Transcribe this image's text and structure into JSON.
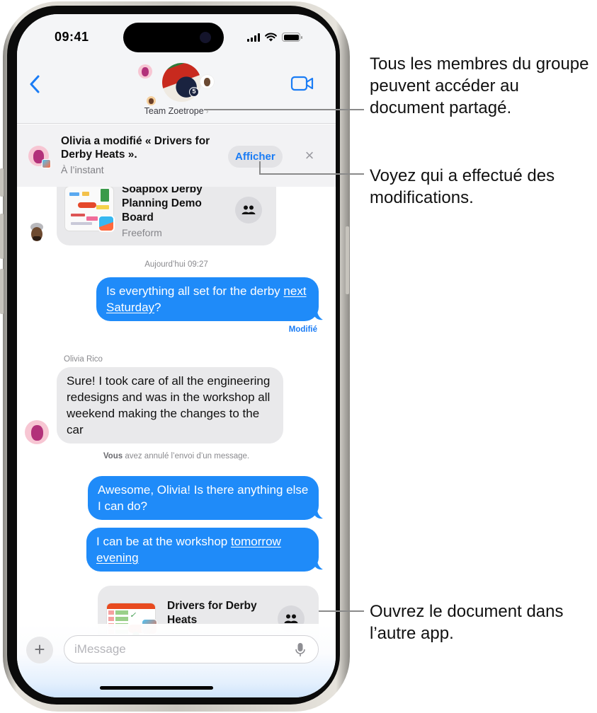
{
  "status_bar": {
    "time": "09:41"
  },
  "header": {
    "group_name": "Team Zoetrope",
    "group_chevron": "›",
    "group_badge_number": "5"
  },
  "notification": {
    "title": "Olivia a modifié « Drivers for Derby Heats ».",
    "subtitle": "À l’instant",
    "action_label": "Afficher",
    "close_glyph": "×"
  },
  "messages": {
    "shared_card_top": {
      "title": "Soapbox Derby Planning Demo Board",
      "app": "Freeform"
    },
    "timestamp": "Aujourd’hui 09:27",
    "outgoing_1": {
      "text_before": "Is everything all set for the derby ",
      "link": "next Saturday",
      "text_after": "?"
    },
    "edited_label": "Modifié",
    "sender_name": "Olivia Rico",
    "incoming_1": "Sure! I took care of all the engineering redesigns and was in the workshop all weekend making the changes to the car",
    "unsent_notice": {
      "bold": "Vous",
      "rest": " avez annulé l’envoi d’un message."
    },
    "outgoing_2": "Awesome, Olivia! Is there anything else I can do?",
    "outgoing_3": {
      "text_before": "I can be at the workshop ",
      "link": "tomorrow evening",
      "text_after": ""
    },
    "shared_card_bottom": {
      "title": "Drivers for Derby Heats"
    }
  },
  "input": {
    "placeholder": "iMessage",
    "plus_glyph": "+"
  },
  "callouts": {
    "group_access": "Tous les membres du groupe peuvent accéder au document partagé.",
    "see_changes": "Voyez qui a effectué des modifications.",
    "open_document": "Ouvrez le document dans l’autre app."
  },
  "colors": {
    "accent_blue": "#1a7cf5",
    "outgoing_bubble": "#1f8bf9",
    "incoming_bubble": "#e9e9eb"
  }
}
